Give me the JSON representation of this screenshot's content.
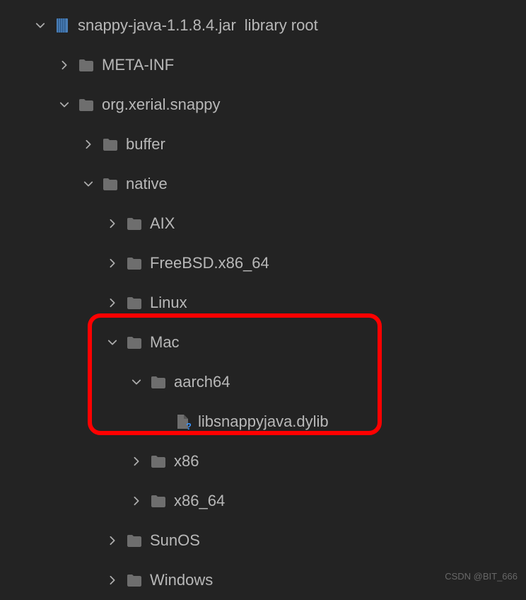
{
  "root": {
    "name": "snappy-java-1.1.8.4.jar",
    "suffix": "library root"
  },
  "tree": {
    "meta_inf": "META-INF",
    "xerial": "org.xerial.snappy",
    "buffer": "buffer",
    "native": "native",
    "aix": "AIX",
    "freebsd": "FreeBSD.x86_64",
    "linux": "Linux",
    "mac": "Mac",
    "aarch64": "aarch64",
    "dylib": "libsnappyjava.dylib",
    "x86": "x86",
    "x86_64": "x86_64",
    "sunos": "SunOS",
    "windows": "Windows"
  },
  "watermark": "CSDN @BIT_666"
}
